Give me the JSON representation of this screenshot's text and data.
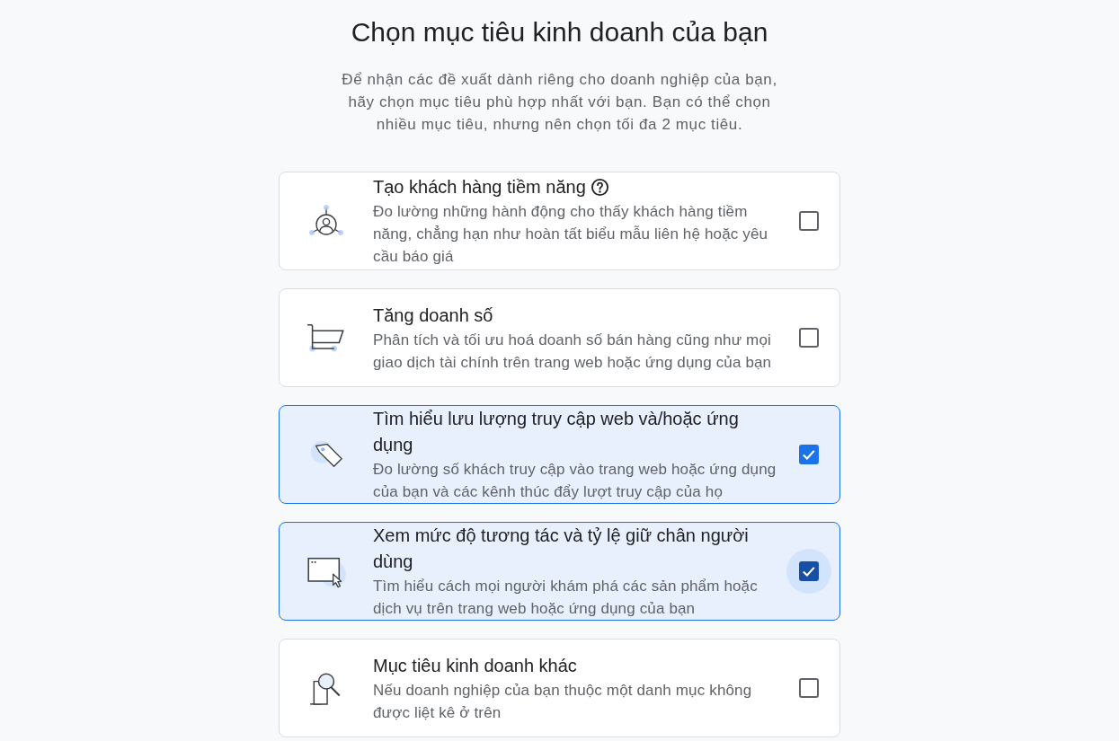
{
  "title": "Chọn mục tiêu kinh doanh của bạn",
  "description": "Để nhận các đề xuất dành riêng cho doanh nghiệp của bạn, hãy chọn mục tiêu phù hợp nhất với bạn. Bạn có thể chọn nhiều mục tiêu, nhưng nên chọn tối đa 2 mục tiêu.",
  "goals": [
    {
      "title": "Tạo khách hàng tiềm năng",
      "help": true,
      "description": "Đo lường những hành động cho thấy khách hàng tiềm năng, chẳng hạn như hoàn tất biểu mẫu liên hệ hoặc yêu cầu báo giá",
      "selected": false,
      "focused": false
    },
    {
      "title": "Tăng doanh số",
      "help": false,
      "description": "Phân tích và tối ưu hoá doanh số bán hàng cũng như mọi giao dịch tài chính trên trang web hoặc ứng dụng của bạn",
      "selected": false,
      "focused": false
    },
    {
      "title": "Tìm hiểu lưu lượng truy cập web và/hoặc ứng dụng",
      "help": false,
      "description": "Đo lường số khách truy cập vào trang web hoặc ứng dụng của bạn và các kênh thúc đẩy lượt truy cập của họ",
      "selected": true,
      "focused": false
    },
    {
      "title": "Xem mức độ tương tác và tỷ lệ giữ chân người dùng",
      "help": false,
      "description": "Tìm hiểu cách mọi người khám phá các sản phẩm hoặc dịch vụ trên trang web hoặc ứng dụng của bạn",
      "selected": true,
      "focused": true
    },
    {
      "title": "Mục tiêu kinh doanh khác",
      "help": false,
      "description": "Nếu doanh nghiệp của bạn thuộc một danh mục không được liệt kê ở trên",
      "selected": false,
      "focused": false
    }
  ]
}
